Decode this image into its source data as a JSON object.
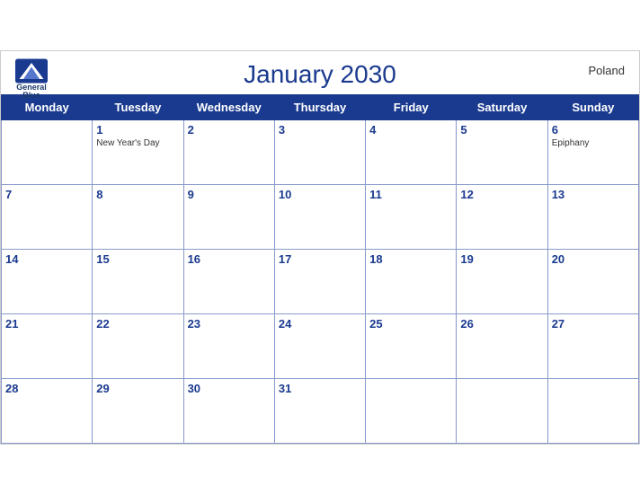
{
  "header": {
    "title": "January 2030",
    "country": "Poland",
    "logo_general": "General",
    "logo_blue": "Blue"
  },
  "weekdays": [
    "Monday",
    "Tuesday",
    "Wednesday",
    "Thursday",
    "Friday",
    "Saturday",
    "Sunday"
  ],
  "weeks": [
    [
      {
        "day": "",
        "holiday": ""
      },
      {
        "day": "1",
        "holiday": "New Year's Day"
      },
      {
        "day": "2",
        "holiday": ""
      },
      {
        "day": "3",
        "holiday": ""
      },
      {
        "day": "4",
        "holiday": ""
      },
      {
        "day": "5",
        "holiday": ""
      },
      {
        "day": "6",
        "holiday": "Epiphany"
      }
    ],
    [
      {
        "day": "7",
        "holiday": ""
      },
      {
        "day": "8",
        "holiday": ""
      },
      {
        "day": "9",
        "holiday": ""
      },
      {
        "day": "10",
        "holiday": ""
      },
      {
        "day": "11",
        "holiday": ""
      },
      {
        "day": "12",
        "holiday": ""
      },
      {
        "day": "13",
        "holiday": ""
      }
    ],
    [
      {
        "day": "14",
        "holiday": ""
      },
      {
        "day": "15",
        "holiday": ""
      },
      {
        "day": "16",
        "holiday": ""
      },
      {
        "day": "17",
        "holiday": ""
      },
      {
        "day": "18",
        "holiday": ""
      },
      {
        "day": "19",
        "holiday": ""
      },
      {
        "day": "20",
        "holiday": ""
      }
    ],
    [
      {
        "day": "21",
        "holiday": ""
      },
      {
        "day": "22",
        "holiday": ""
      },
      {
        "day": "23",
        "holiday": ""
      },
      {
        "day": "24",
        "holiday": ""
      },
      {
        "day": "25",
        "holiday": ""
      },
      {
        "day": "26",
        "holiday": ""
      },
      {
        "day": "27",
        "holiday": ""
      }
    ],
    [
      {
        "day": "28",
        "holiday": ""
      },
      {
        "day": "29",
        "holiday": ""
      },
      {
        "day": "30",
        "holiday": ""
      },
      {
        "day": "31",
        "holiday": ""
      },
      {
        "day": "",
        "holiday": ""
      },
      {
        "day": "",
        "holiday": ""
      },
      {
        "day": "",
        "holiday": ""
      }
    ]
  ]
}
